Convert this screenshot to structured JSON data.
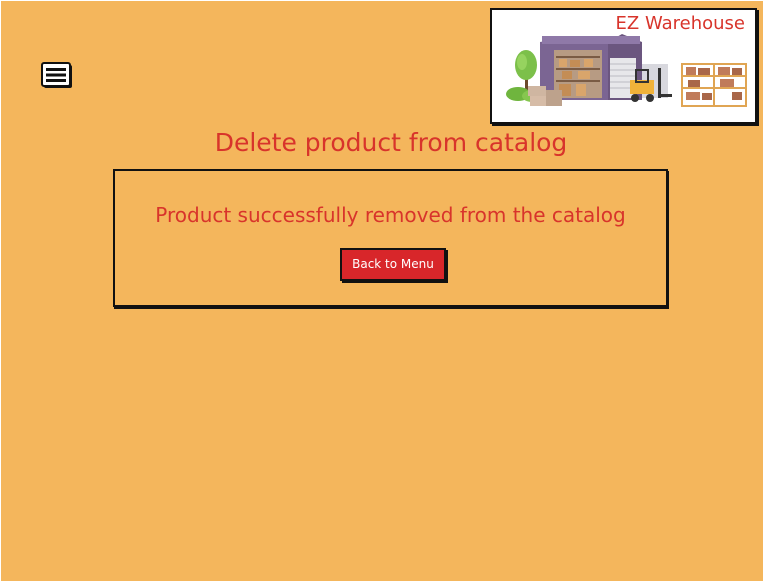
{
  "header": {
    "menu_icon": "hamburger-menu-icon",
    "logo": {
      "title": "EZ Warehouse",
      "illustration": "warehouse-illustration"
    }
  },
  "main": {
    "title": "Delete product from catalog",
    "message": "Product successfully removed from the catalog",
    "back_button_label": "Back to Menu"
  },
  "colors": {
    "background": "#f4b65c",
    "accent": "#d8342b",
    "button": "#d8262a",
    "border": "#111111"
  }
}
